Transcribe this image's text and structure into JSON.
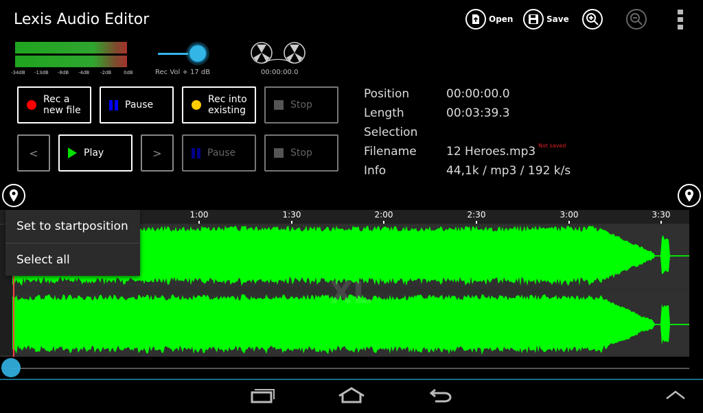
{
  "app": {
    "title": "Lexis Audio Editor"
  },
  "toolbar": {
    "open_label": "Open",
    "save_label": "Save"
  },
  "meter": {
    "ticks": [
      "-34dB",
      "-13dB",
      "-8dB",
      "-4dB",
      "-2dB",
      "0dB"
    ]
  },
  "rec_volume": {
    "label": "Rec Vol + 17 dB",
    "level": 0.75
  },
  "tape": {
    "time": "00:00:00.0"
  },
  "buttons": {
    "rec_new": "Rec a\nnew file",
    "pause_rec": "Pause",
    "rec_into": "Rec into\nexisting",
    "stop_rec": "Stop",
    "prev": "<",
    "play": "Play",
    "next": ">",
    "pause_play": "Pause",
    "stop_play": "Stop"
  },
  "info": {
    "position_label": "Position",
    "position_value": "00:00:00.0",
    "length_label": "Length",
    "length_value": "00:03:39.3",
    "selection_label": "Selection",
    "selection_value": "",
    "filename_label": "Filename",
    "filename_value": "12 Heroes.mp3",
    "not_saved": "Not saved",
    "info_label": "Info",
    "info_value": "44,1k / mp3 / 192 k/s"
  },
  "timeline": {
    "ticks": [
      "1:00",
      "1:30",
      "2:00",
      "2:30",
      "3:00",
      "3:30"
    ]
  },
  "watermark": "XL",
  "context_menu": {
    "items": [
      "Set to startposition",
      "Select all"
    ]
  },
  "colors": {
    "accent": "#33b5e5",
    "waveform": "#00ff00",
    "record": "#ff0000",
    "pause_blue": "#0000ff",
    "rec_into_yellow": "#ffcc00",
    "play_green": "#00e000"
  }
}
